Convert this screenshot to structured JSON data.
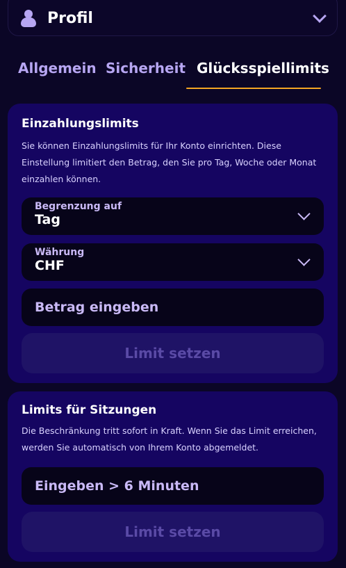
{
  "profile": {
    "title": "Profil",
    "icon": "user-icon",
    "chevron_icon": "chevron-down-icon"
  },
  "tabs": [
    {
      "label": "Allgemein",
      "active": false
    },
    {
      "label": "Sicherheit",
      "active": false
    },
    {
      "label": "Glücksspiellimits",
      "active": true
    }
  ],
  "deposit_limits": {
    "title": "Einzahlungslimits",
    "description": "Sie können Einzahlungslimits für Ihr Konto einrichten. Diese Einstellung limitiert den Betrag, den Sie pro Tag, Woche oder Monat einzahlen können.",
    "period_field": {
      "label": "Begrenzung auf",
      "value": "Tag"
    },
    "currency_field": {
      "label": "Währung",
      "value": "CHF"
    },
    "amount_placeholder": "Betrag eingeben",
    "button_label": "Limit setzen"
  },
  "session_limits": {
    "title": "Limits für Sitzungen",
    "description": "Die Beschränkung tritt sofort in Kraft. Wenn Sie das Limit erreichen, werden Sie automatisch von Ihrem Konto abgemeldet.",
    "input_placeholder": "Eingeben > 6 Minuten",
    "button_label": "Limit setzen"
  },
  "colors": {
    "background": "#0b0626",
    "card": "#150561",
    "field": "#070419",
    "accent_underline": "#f5a623",
    "muted_text": "#b7a6f2",
    "disabled_button": "#1f1366"
  }
}
